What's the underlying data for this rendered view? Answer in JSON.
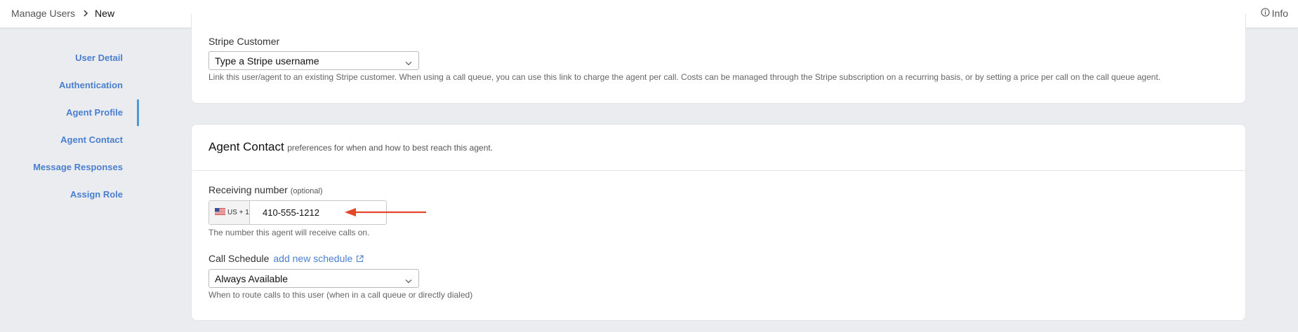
{
  "header": {
    "breadcrumb_parent": "Manage Users",
    "breadcrumb_current": "New",
    "info_label": "Info"
  },
  "sidebar": {
    "items": [
      {
        "label": "User Detail"
      },
      {
        "label": "Authentication"
      },
      {
        "label": "Agent Profile",
        "active": true
      },
      {
        "label": "Agent Contact"
      },
      {
        "label": "Message Responses"
      },
      {
        "label": "Assign Role"
      }
    ]
  },
  "stripe": {
    "label": "Stripe Customer",
    "select_value": "Type a Stripe username",
    "help": "Link this user/agent to an existing Stripe customer. When using a call queue, you can use this link to charge the agent per call. Costs can be managed through the Stripe subscription on a recurring basis, or by setting a price per call on the call queue agent."
  },
  "agent_contact": {
    "title": "Agent Contact",
    "subtitle": "preferences for when and how to best reach this agent.",
    "receiving_label": "Receiving number",
    "receiving_optional": "(optional)",
    "country_code": "US + 1",
    "phone_value": "410-555-1212",
    "receiving_help": "The number this agent will receive calls on.",
    "schedule_label": "Call Schedule",
    "schedule_link": "add new schedule",
    "schedule_value": "Always Available",
    "schedule_help": "When to route calls to this user (when in a call queue or directly dialed)"
  },
  "colors": {
    "accent": "#4a7fcf",
    "active_bar": "#4a9ade",
    "annotation_arrow": "#e4462a"
  },
  "icons": [
    "chevron-right-icon",
    "info-icon",
    "chevron-down-icon",
    "us-flag-icon",
    "external-link-icon",
    "arrow-annotation"
  ]
}
